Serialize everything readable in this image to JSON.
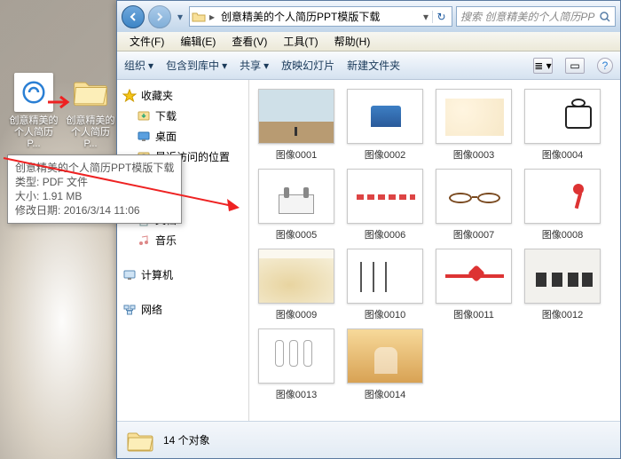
{
  "desktop": {
    "icon_pdf_label": "创意精美的个人简历P...",
    "icon_folder_label": "创意精美的个人简历P..."
  },
  "tooltip": {
    "line1": "创意精美的个人简历PPT模版下载",
    "line2_label": "类型:",
    "line2_value": "PDF 文件",
    "line3_label": "大小:",
    "line3_value": "1.91 MB",
    "line4_label": "修改日期:",
    "line4_value": "2016/3/14 11:06"
  },
  "explorer": {
    "breadcrumb": "创意精美的个人简历PPT模版下载",
    "search_placeholder": "搜索 创意精美的个人简历PPT模版下载",
    "menu": {
      "file": "文件(F)",
      "edit": "编辑(E)",
      "view": "查看(V)",
      "tools": "工具(T)",
      "help": "帮助(H)"
    },
    "toolbar": {
      "organize": "组织",
      "include": "包含到库中",
      "share": "共享",
      "slideshow": "放映幻灯片",
      "newfolder": "新建文件夹"
    },
    "sidebar": {
      "favorites": "收藏夹",
      "downloads": "下载",
      "desktop": "桌面",
      "recent": "最近访问的位置",
      "documents": "文档",
      "music": "音乐",
      "computer": "计算机",
      "network": "网络"
    },
    "items": [
      {
        "label": "图像0001"
      },
      {
        "label": "图像0002"
      },
      {
        "label": "图像0003"
      },
      {
        "label": "图像0004"
      },
      {
        "label": "图像0005"
      },
      {
        "label": "图像0006"
      },
      {
        "label": "图像0007"
      },
      {
        "label": "图像0008"
      },
      {
        "label": "图像0009"
      },
      {
        "label": "图像0010"
      },
      {
        "label": "图像0011"
      },
      {
        "label": "图像0012"
      },
      {
        "label": "图像0013"
      },
      {
        "label": "图像0014"
      }
    ],
    "status": "14 个对象"
  }
}
